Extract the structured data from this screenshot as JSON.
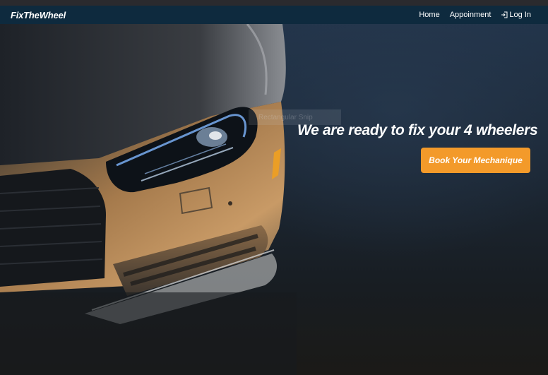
{
  "navbar": {
    "brand": "FixTheWheel",
    "links": [
      {
        "label": "Home"
      },
      {
        "label": "Appoinment"
      },
      {
        "label": "Log In",
        "icon": "login-icon"
      }
    ],
    "background": "#0e2a3e"
  },
  "hero": {
    "overlay_text": "Rectangular Snip",
    "headline": "We are ready to fix your 4 wheelers",
    "cta_label": "Book Your Mechanique",
    "cta_color": "#f39a2a",
    "image": "car-headlight-photo"
  }
}
